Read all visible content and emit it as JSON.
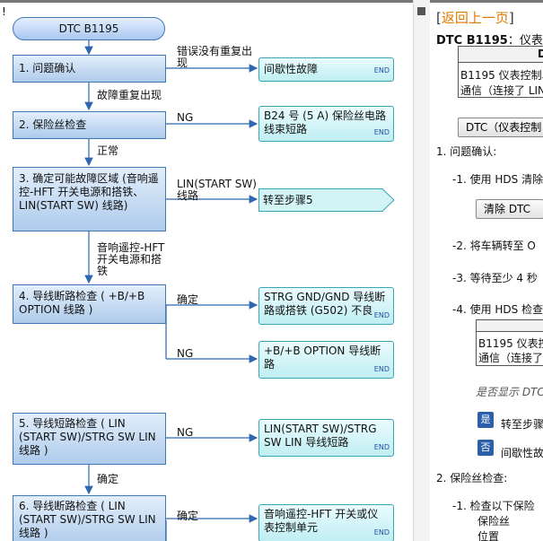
{
  "corner_mark": "!",
  "flowchart": {
    "start": "DTC B1195",
    "steps": [
      "1.  问题确认",
      "2.  保险丝检查",
      "3.  确定可能故障区域 (音响遥控-HFT 开关电源和搭铁、LIN(START SW) 线路)",
      "4.  导线断路检查 ( +B/+B OPTION 线路 )",
      "5.  导线短路检查 ( LIN (START SW)/STRG SW LIN 线路 )",
      "6.  导线断路检查 ( LIN (START SW)/STRG SW LIN 线路 )"
    ],
    "results": [
      "间歇性故障",
      "B24 号 (5 A) 保险丝电路线束短路",
      "转至步骤5",
      "STRG GND/GND 导线断路或搭铁 (G502) 不良",
      "+B/+B OPTION 导线断路",
      "LIN(START SW)/STRG SW LIN 导线短路",
      "音响遥控-HFT 开关或仪表控制单元"
    ],
    "end_label": "END",
    "labels": {
      "l1": "错误没有重复出现",
      "l2": "故障重复出现",
      "l3": "NG",
      "l4": "正常",
      "l5": "LIN(START SW) 线路",
      "l6": "音响遥控-HFT 开关电源和搭铁",
      "l7": "确定",
      "l8": "NG",
      "l9": "NG",
      "l10": "确定",
      "l11": "确定"
    }
  },
  "doc": {
    "back_open": "[",
    "back_link": "返回上一页",
    "back_close": "]",
    "title_code": "DTC B1195",
    "title_rest": "：仪表",
    "table_header": "D",
    "table_row1": "B1195 仪表控制单",
    "table_row2": "通信（连接了 LIN",
    "dtc_button": "DTC（仪表控制",
    "s1": "1.  问题确认:",
    "s1_1": "-1.   使用 HDS 清除",
    "clear_button": "清除 DTC",
    "s1_2": "-2.   将车辆转至 O",
    "s1_3": "-3.   等待至少 4 秒",
    "s1_4": "-4.   使用 HDS 检查",
    "table2_row1": "B1195 仪表控",
    "table2_row2": "通信（连接了",
    "question": "是否显示 DTC",
    "yes_icon": "是",
    "yes_text": "转至步骤",
    "no_icon": "否",
    "no_text": "间歇性故",
    "s2": "2.  保险丝检查:",
    "s2_1": "-1.   检查以下保险",
    "fuse_label": "保险丝",
    "pos_label": "位置"
  },
  "colors": {
    "step_border": "#3f78b5",
    "result_border": "#3aa6b3",
    "link": "#e07a00"
  }
}
